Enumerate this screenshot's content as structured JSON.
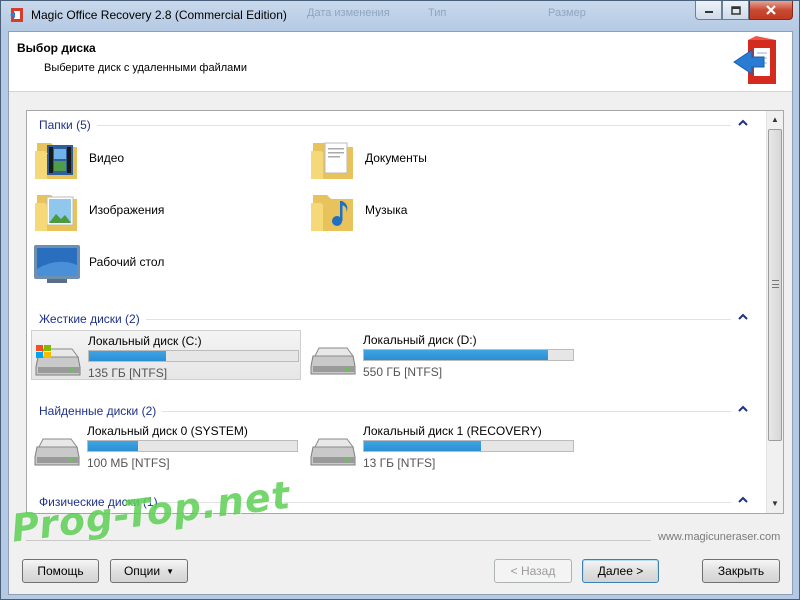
{
  "window": {
    "title": "Magic Office Recovery 2.8 (Commercial Edition)",
    "ghost_headers": [
      "Дата изменения",
      "Тип",
      "Размер"
    ]
  },
  "header": {
    "title": "Выбор диска",
    "subtitle": "Выберите диск с удаленными файлами"
  },
  "groups": {
    "folders": {
      "label": "Папки (5)",
      "items": [
        {
          "label": "Видео",
          "icon": "video-folder-icon"
        },
        {
          "label": "Документы",
          "icon": "documents-folder-icon"
        },
        {
          "label": "Изображения",
          "icon": "pictures-folder-icon"
        },
        {
          "label": "Музыка",
          "icon": "music-folder-icon"
        },
        {
          "label": "Рабочий стол",
          "icon": "desktop-icon"
        }
      ]
    },
    "hard_drives": {
      "label": "Жесткие диски (2)",
      "items": [
        {
          "name": "Локальный диск (C:)",
          "info": "135 ГБ [NTFS]",
          "used": 0.37,
          "selected": true
        },
        {
          "name": "Локальный диск (D:)",
          "info": "550 ГБ [NTFS]",
          "used": 0.88,
          "selected": false
        }
      ]
    },
    "found_drives": {
      "label": "Найденные диски (2)",
      "items": [
        {
          "name": "Локальный диск 0 (SYSTEM)",
          "info": "100 МБ [NTFS]",
          "used": 0.24
        },
        {
          "name": "Локальный диск 1 (RECOVERY)",
          "info": "13 ГБ [NTFS]",
          "used": 0.56
        }
      ]
    },
    "physical_drives": {
      "label": "Физические диски (1)"
    }
  },
  "footer": {
    "site": "www.magicuneraser.com",
    "help_label": "Помощь",
    "options_label": "Опции",
    "back_label": "< Назад",
    "next_label": "Далее >",
    "close_label": "Закрыть"
  },
  "watermark": "Prog-Top.net",
  "colors": {
    "group_label": "#1e3287",
    "progress_fill": "#2b8fd2",
    "title_bar": "#b4c9e3",
    "watermark": "#46c83c"
  }
}
